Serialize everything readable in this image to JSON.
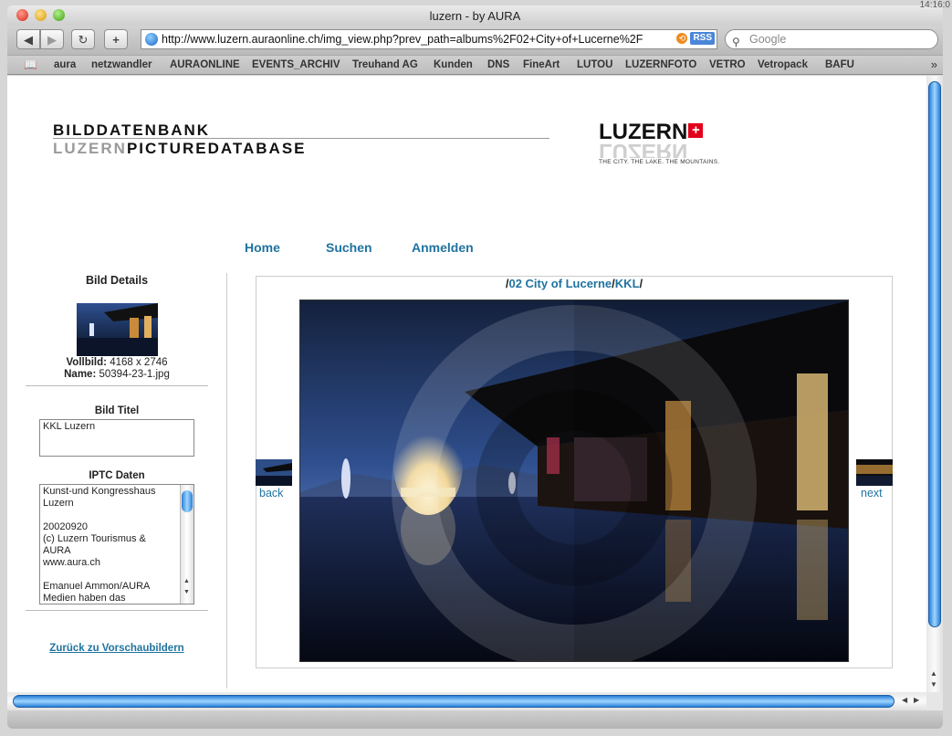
{
  "window": {
    "title": "luzern - by AURA",
    "clock": "14:16:0"
  },
  "toolbar": {
    "back_label": "◀",
    "forward_label": "▶",
    "reload_label": "↻",
    "add_label": "+",
    "url": "http://www.luzern.auraonline.ch/img_view.php?prev_path=albums%2F02+City+of+Lucerne%2F",
    "rss_label": "RSS",
    "search_placeholder": "Google"
  },
  "bookmarks": [
    "aura",
    "netzwandler",
    "AURAONLINE",
    "EVENTS_ARCHIV",
    "Treuhand AG",
    "Kunden",
    "DNS",
    "FineArt",
    "LUTOU",
    "LUZERNFOTO",
    "VETRO",
    "Vetropack",
    "BAFU"
  ],
  "header": {
    "line1": "BILDDATENBANK",
    "line2_grey": "LUZERN",
    "line2_black": "PICTUREDATABASE",
    "logo_word": "LUZERN",
    "logo_cross": "+",
    "logo_tagline": "THE CITY. THE LAKE. THE MOUNTAINS."
  },
  "nav": [
    "Home",
    "Suchen",
    "Anmelden"
  ],
  "sidebar": {
    "title": "Bild Details",
    "vollbild_label": "Vollbild:",
    "vollbild_value": "4168 x 2746",
    "name_label": "Name:",
    "name_value": "50394-23-1.jpg",
    "bildtitel_label": "Bild Titel",
    "bildtitel_value": "KKL Luzern",
    "iptc_label": "IPTC Daten",
    "iptc_lines": [
      "Kunst-und Kongresshaus",
      "Luzern",
      "",
      "20020920",
      "(c) Luzern Tourismus &",
      "AURA",
      "www.aura.ch",
      "",
      "Emanuel Ammon/AURA",
      "Medien haben das"
    ],
    "back_link": "Zurück zu Vorschaubildern"
  },
  "breadcrumb": {
    "sep1": "/",
    "album": "02 City of Lucerne",
    "sep2": "/",
    "sub": "KKL",
    "sep3": "/"
  },
  "viewer": {
    "back_label": "back",
    "next_label": "next"
  }
}
